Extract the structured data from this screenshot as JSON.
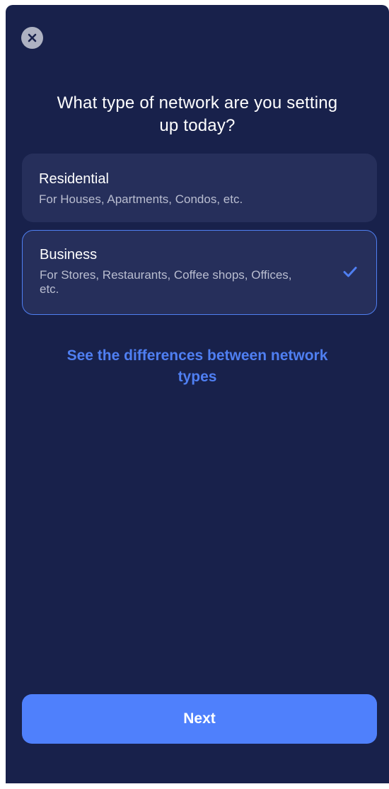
{
  "header": {
    "close_icon": "close-icon",
    "title": "What type of network are you setting up today?"
  },
  "options": [
    {
      "title": "Residential",
      "description": "For Houses, Apartments, Condos, etc.",
      "selected": false
    },
    {
      "title": "Business",
      "description": "For Stores, Restaurants, Coffee shops, Offices, etc.",
      "selected": true,
      "selected_icon": "checkmark-icon"
    }
  ],
  "link": {
    "label": "See the differences between network types"
  },
  "footer": {
    "next_label": "Next"
  },
  "colors": {
    "background": "#18214b",
    "card": "#262f5b",
    "accent": "#4f7ff2",
    "button": "#4f80fc",
    "text_secondary": "#b9bdd0"
  }
}
